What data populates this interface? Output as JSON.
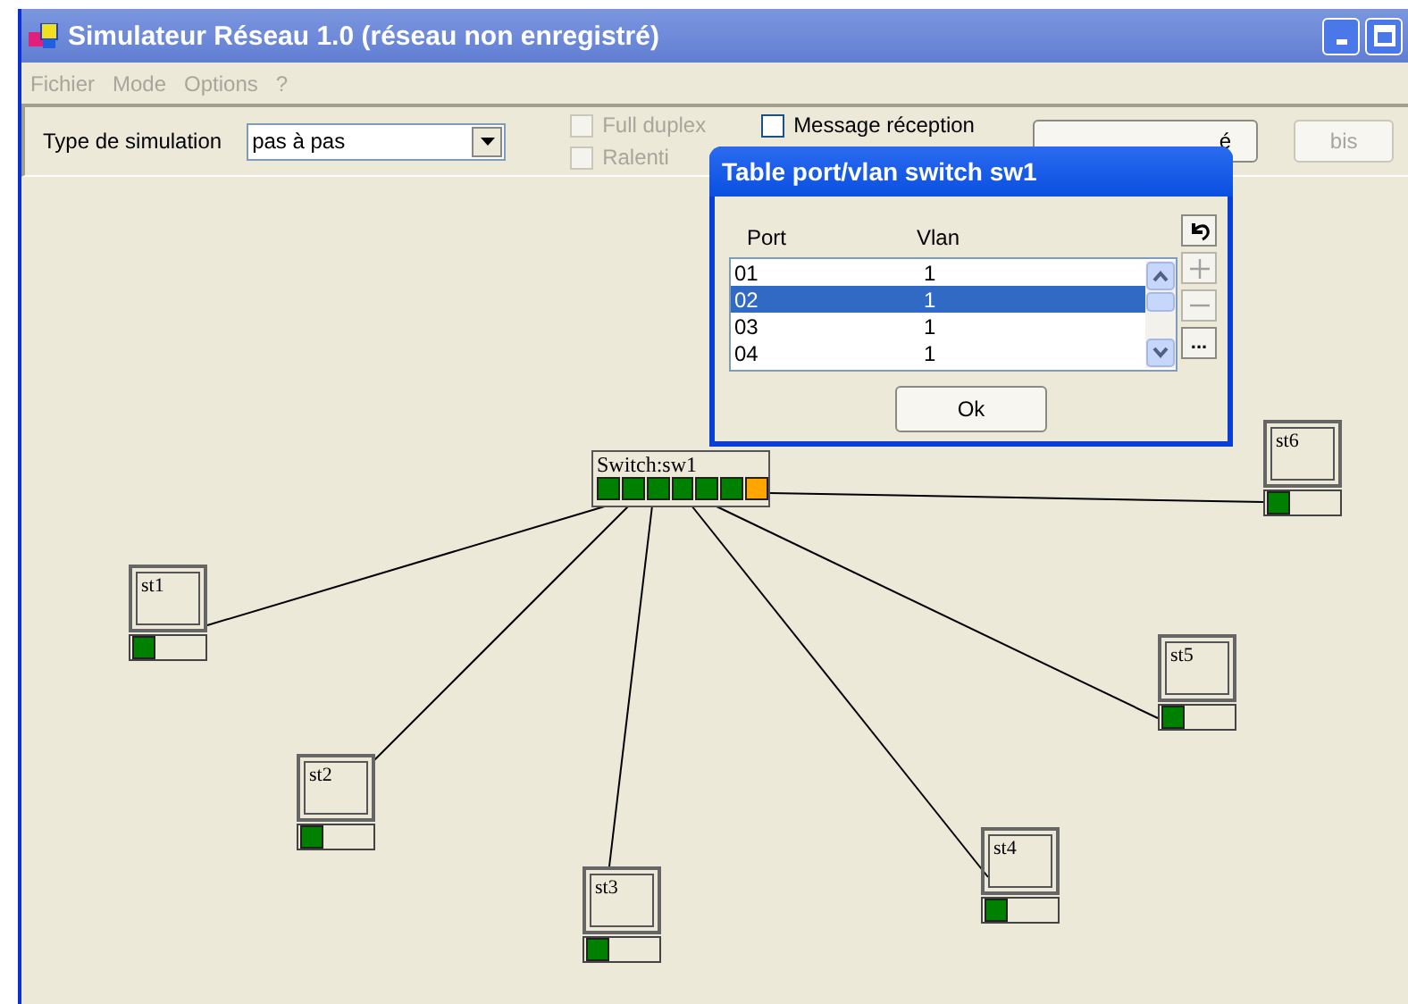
{
  "window": {
    "title": "Simulateur Réseau 1.0 (réseau non enregistré)"
  },
  "menu": [
    {
      "label": "Fichier",
      "disabled": true
    },
    {
      "label": "Mode",
      "disabled": true
    },
    {
      "label": "Options",
      "disabled": true
    },
    {
      "label": "?",
      "disabled": true
    }
  ],
  "toolbar": {
    "simulation_label": "Type de simulation",
    "simulation_type": "pas à pas",
    "checkboxes": [
      {
        "label": "Full duplex",
        "checked": false,
        "disabled": true
      },
      {
        "label": "Ralenti",
        "checked": false,
        "disabled": true
      },
      {
        "label": "Message réception",
        "checked": false,
        "disabled": false
      }
    ],
    "buttons": [
      {
        "label": "é",
        "disabled": false
      },
      {
        "label": "bis",
        "disabled": true
      }
    ]
  },
  "network": {
    "switch": {
      "label": "Switch:sw1",
      "ports": [
        {
          "color": "#008000"
        },
        {
          "color": "#008000"
        },
        {
          "color": "#008000"
        },
        {
          "color": "#008000"
        },
        {
          "color": "#008000"
        },
        {
          "color": "#008000"
        },
        {
          "color": "#ffa500"
        }
      ]
    },
    "stations": [
      {
        "label": "st1",
        "color": "#008000"
      },
      {
        "label": "st2",
        "color": "#008000"
      },
      {
        "label": "st3",
        "color": "#008000"
      },
      {
        "label": "st4",
        "color": "#008000"
      },
      {
        "label": "st5",
        "color": "#008000"
      },
      {
        "label": "st6",
        "color": "#008000"
      }
    ]
  },
  "dialog": {
    "title": "Table port/vlan switch sw1",
    "columns": [
      "Port",
      "Vlan"
    ],
    "rows": [
      {
        "port": "01",
        "vlan": "1",
        "selected": false
      },
      {
        "port": "02",
        "vlan": "1",
        "selected": true
      },
      {
        "port": "03",
        "vlan": "1",
        "selected": false
      },
      {
        "port": "04",
        "vlan": "1",
        "selected": false
      }
    ],
    "side_buttons": [
      {
        "kind": "undo",
        "disabled": false
      },
      {
        "kind": "plus",
        "disabled": true
      },
      {
        "kind": "minus",
        "disabled": true
      },
      {
        "kind": "more",
        "label": "...",
        "disabled": false
      }
    ],
    "ok": "Ok"
  }
}
